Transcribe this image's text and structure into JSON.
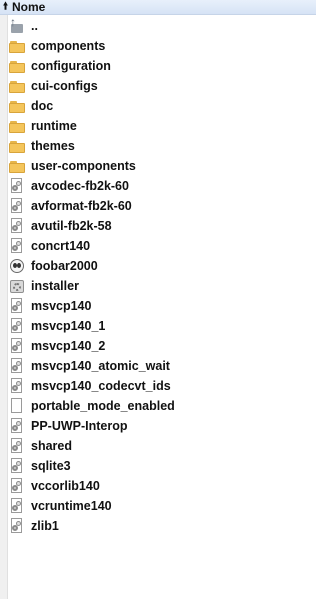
{
  "header": {
    "label": "Nome",
    "sort_icon": "up-arrow-icon"
  },
  "items": [
    {
      "name": "..",
      "kind": "up",
      "icon": "parent-folder-icon"
    },
    {
      "name": "components",
      "kind": "folder",
      "icon": "folder-icon"
    },
    {
      "name": "configuration",
      "kind": "folder",
      "icon": "folder-icon"
    },
    {
      "name": "cui-configs",
      "kind": "folder",
      "icon": "folder-icon"
    },
    {
      "name": "doc",
      "kind": "folder",
      "icon": "folder-icon"
    },
    {
      "name": "runtime",
      "kind": "folder",
      "icon": "folder-icon"
    },
    {
      "name": "themes",
      "kind": "folder",
      "icon": "folder-icon"
    },
    {
      "name": "user-components",
      "kind": "folder",
      "icon": "folder-icon"
    },
    {
      "name": "avcodec-fb2k-60",
      "kind": "file",
      "icon": "dll-file-icon"
    },
    {
      "name": "avformat-fb2k-60",
      "kind": "file",
      "icon": "dll-file-icon"
    },
    {
      "name": "avutil-fb2k-58",
      "kind": "file",
      "icon": "dll-file-icon"
    },
    {
      "name": "concrt140",
      "kind": "file",
      "icon": "dll-file-icon"
    },
    {
      "name": "foobar2000",
      "kind": "foobar",
      "icon": "foobar2000-app-icon"
    },
    {
      "name": "installer",
      "kind": "installer",
      "icon": "installer-icon"
    },
    {
      "name": "msvcp140",
      "kind": "file",
      "icon": "dll-file-icon"
    },
    {
      "name": "msvcp140_1",
      "kind": "file",
      "icon": "dll-file-icon"
    },
    {
      "name": "msvcp140_2",
      "kind": "file",
      "icon": "dll-file-icon"
    },
    {
      "name": "msvcp140_atomic_wait",
      "kind": "file",
      "icon": "dll-file-icon"
    },
    {
      "name": "msvcp140_codecvt_ids",
      "kind": "file",
      "icon": "dll-file-icon"
    },
    {
      "name": "portable_mode_enabled",
      "kind": "blank",
      "icon": "blank-file-icon"
    },
    {
      "name": "PP-UWP-Interop",
      "kind": "file",
      "icon": "dll-file-icon"
    },
    {
      "name": "shared",
      "kind": "file",
      "icon": "dll-file-icon"
    },
    {
      "name": "sqlite3",
      "kind": "file",
      "icon": "dll-file-icon"
    },
    {
      "name": "vccorlib140",
      "kind": "file",
      "icon": "dll-file-icon"
    },
    {
      "name": "vcruntime140",
      "kind": "file",
      "icon": "dll-file-icon"
    },
    {
      "name": "zlib1",
      "kind": "file",
      "icon": "dll-file-icon"
    }
  ]
}
